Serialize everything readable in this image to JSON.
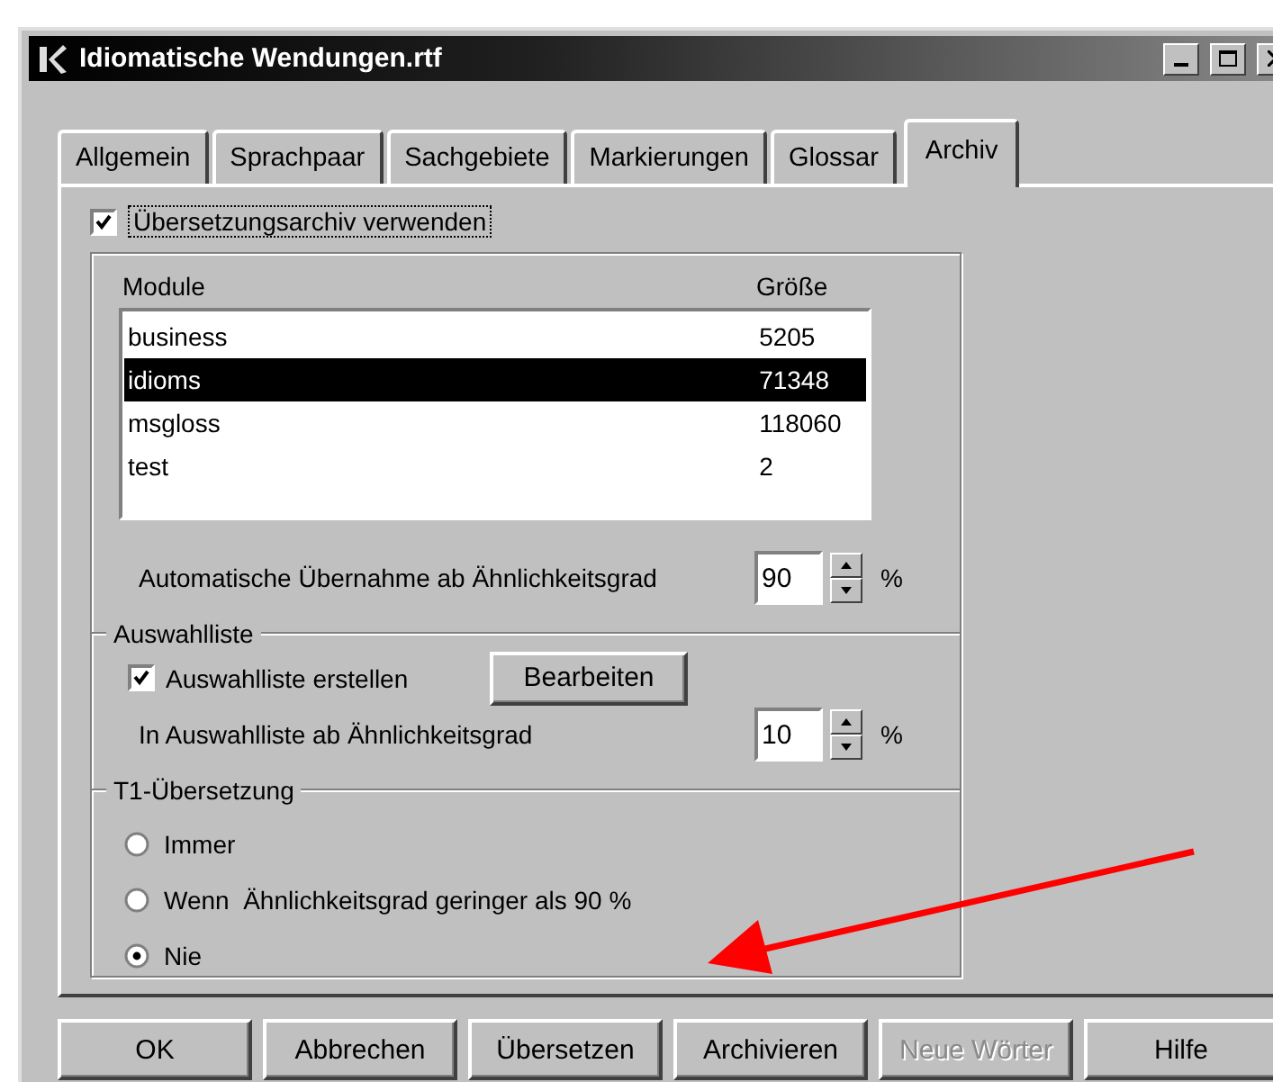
{
  "window": {
    "title": "Idiomatische Wendungen.rtf"
  },
  "tabs": [
    {
      "label": "Allgemein",
      "selected": false
    },
    {
      "label": "Sprachpaar",
      "selected": false
    },
    {
      "label": "Sachgebiete",
      "selected": false
    },
    {
      "label": "Markierungen",
      "selected": false
    },
    {
      "label": "Glossar",
      "selected": false
    },
    {
      "label": "Archiv",
      "selected": true
    }
  ],
  "use_archive": {
    "label": "Übersetzungsarchiv verwenden",
    "checked": true
  },
  "modules": {
    "columns": [
      "Module",
      "Größe"
    ],
    "rows": [
      {
        "name": "business",
        "size": "5205",
        "selected": false
      },
      {
        "name": "idioms",
        "size": "71348",
        "selected": true
      },
      {
        "name": "msgloss",
        "size": "118060",
        "selected": false
      },
      {
        "name": "test",
        "size": "2",
        "selected": false
      }
    ]
  },
  "auto_accept": {
    "label": "Automatische Übernahme ab Ähnlichkeitsgrad",
    "value": "90",
    "unit": "%"
  },
  "selection_list": {
    "title": "Auswahlliste",
    "create": {
      "label": "Auswahlliste erstellen",
      "checked": true
    },
    "edit_button": "Bearbeiten",
    "threshold": {
      "label": "In Auswahlliste ab Ähnlichkeitsgrad",
      "value": "10",
      "unit": "%"
    }
  },
  "t1": {
    "title": "T1-Übersetzung",
    "options": [
      {
        "label": "Immer",
        "selected": false
      },
      {
        "label": "Wenn  Ähnlichkeitsgrad geringer als 90 %",
        "selected": false
      },
      {
        "label": "Nie",
        "selected": true
      }
    ]
  },
  "buttons": [
    {
      "label": "OK",
      "disabled": false
    },
    {
      "label": "Abbrechen",
      "disabled": false
    },
    {
      "label": "Übersetzen",
      "disabled": false
    },
    {
      "label": "Archivieren",
      "disabled": false
    },
    {
      "label": "Neue Wörter",
      "disabled": true
    },
    {
      "label": "Hilfe",
      "disabled": false
    }
  ]
}
